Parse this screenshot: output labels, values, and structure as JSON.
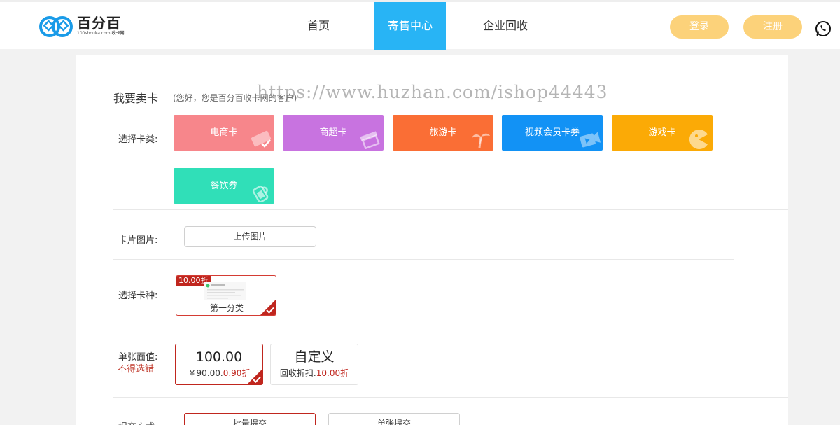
{
  "header": {
    "logo": {
      "name": "百分百",
      "sub": "100shouka.com",
      "sub_tag": "收卡网"
    },
    "nav": {
      "home": "首页",
      "consign": "寄售中心",
      "enterprise": "企业回收"
    },
    "login": "登录",
    "register": "注册",
    "accent_color": "#28b4f5",
    "button_color": "#fcd27a"
  },
  "watermark": "https://www.huzhan.com/ishop44443",
  "sell": {
    "title": "我要卖卡",
    "subtitle": "(您好，您是百分百收卡网的客户)",
    "category_label": "选择卡类:",
    "categories": [
      {
        "label": "电商卡",
        "color": "#f7868b",
        "icon": "ticket-check-icon"
      },
      {
        "label": "商超卡",
        "color": "#c873e0",
        "icon": "shop-awning-icon"
      },
      {
        "label": "旅游卡",
        "color": "#fa6e35",
        "icon": "palm-tree-icon"
      },
      {
        "label": "视频会员卡券",
        "color": "#1292f5",
        "icon": "video-play-icon"
      },
      {
        "label": "游戏卡",
        "color": "#fbaa06",
        "icon": "pacman-icon"
      },
      {
        "label": "餐饮券",
        "color": "#30dfb8",
        "icon": "drink-icon"
      }
    ],
    "image_label": "卡片图片:",
    "upload": "上传图片",
    "kind_label": "选择卡种:",
    "kind": {
      "badge": "10.00折",
      "name": "第一分类"
    },
    "face_label": "单张面值:",
    "face_warning": "不得选错",
    "faces": [
      {
        "value": "100.00",
        "price": "￥90.00.",
        "discount": "0.90折"
      },
      {
        "value": "自定义",
        "price": "回收折扣.",
        "discount": "10.00折"
      }
    ],
    "submit_label": "提交方式:",
    "submit": {
      "batch": "批量提交",
      "single": "单张提交"
    }
  }
}
